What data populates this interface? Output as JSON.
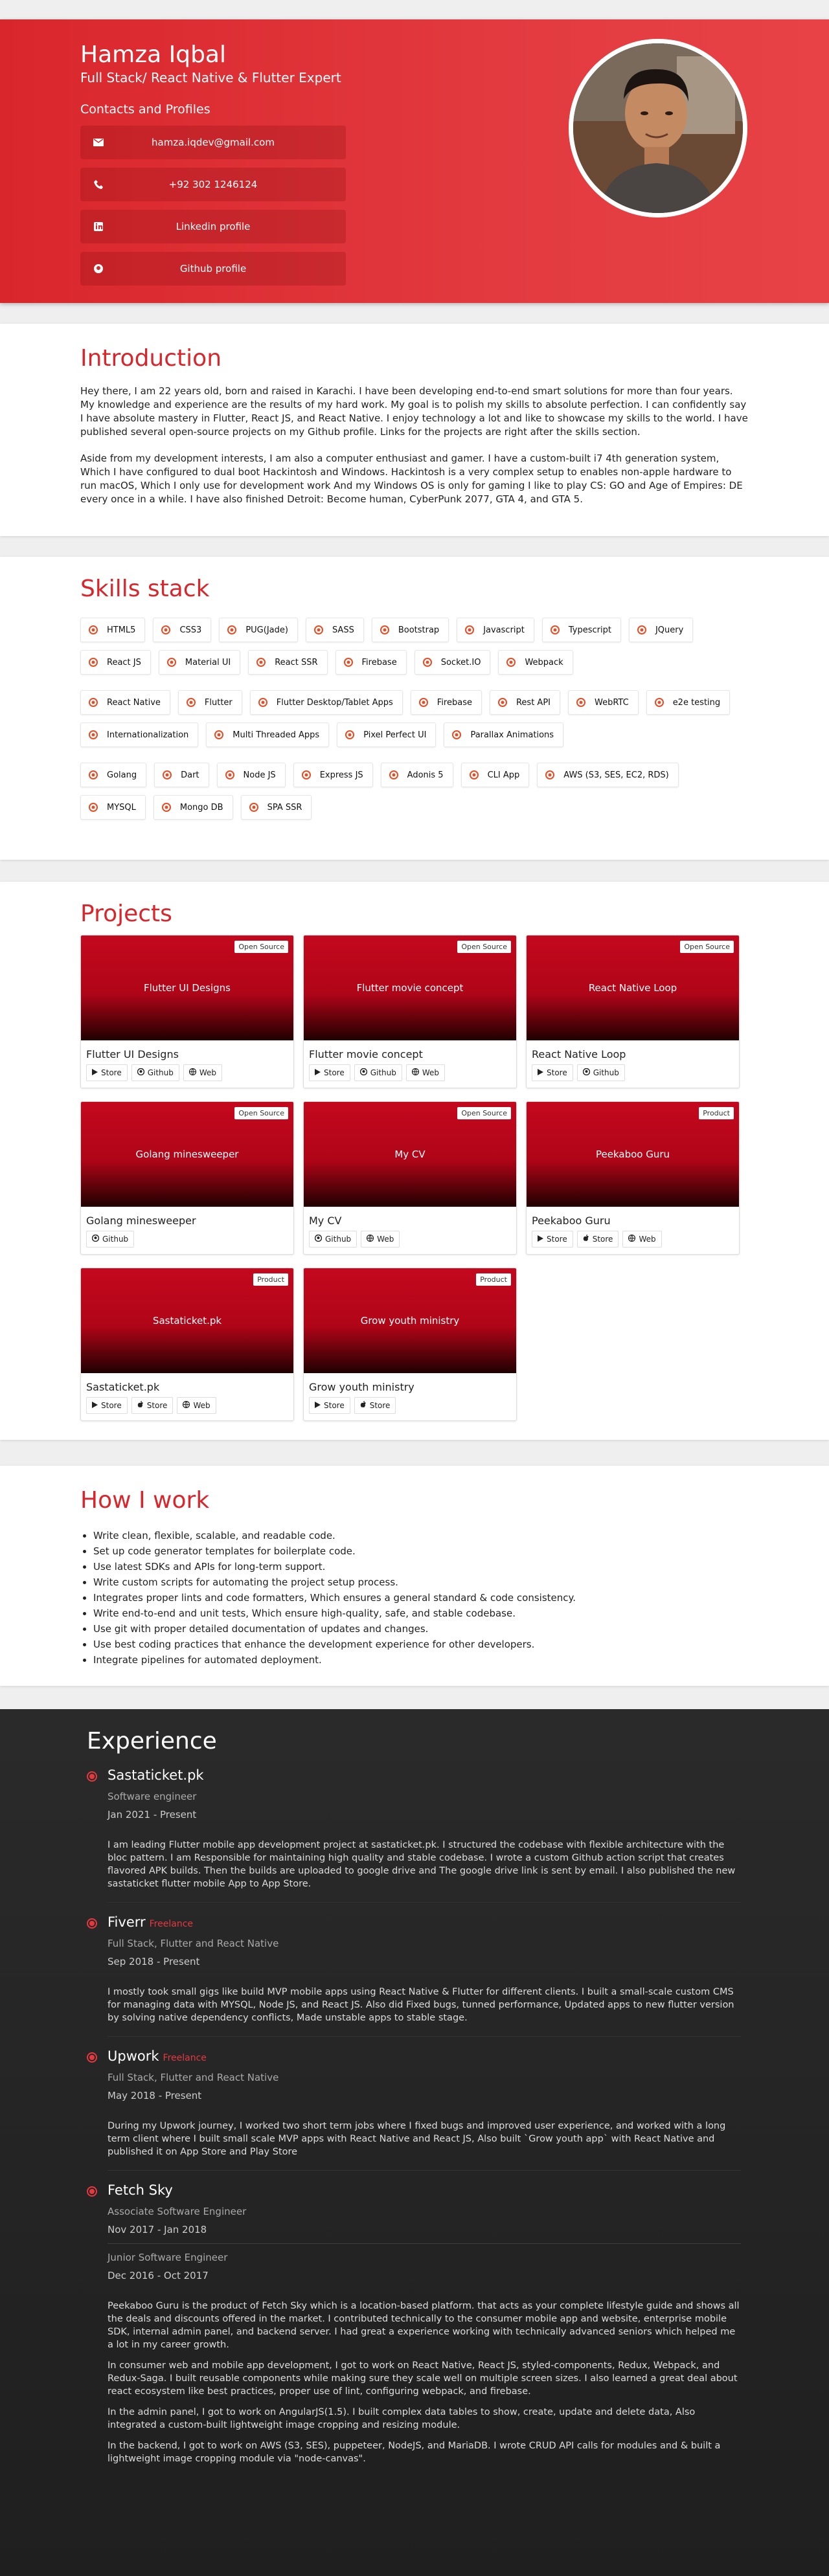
{
  "hero": {
    "name": "Hamza Iqbal",
    "subtitle": "Full Stack/ React Native & Flutter Expert",
    "contacts_title": "Contacts and Profiles",
    "contacts": [
      {
        "icon": "mail-icon",
        "label": "hamza.iqdev@gmail.com"
      },
      {
        "icon": "phone-icon",
        "label": "+92 302 1246124"
      },
      {
        "icon": "linkedin-icon",
        "label": "Linkedin profile"
      },
      {
        "icon": "github-icon",
        "label": "Github profile"
      }
    ]
  },
  "intro": {
    "title": "Introduction",
    "p1": "Hey there, I am 22 years old, born and raised in Karachi. I have been developing end-to-end smart solutions for more than four years. My knowledge and experience are the results of my hard work. My goal is to polish my skills to absolute perfection. I can confidently say I have absolute mastery in Flutter, React JS, and React Native. I enjoy technology a lot and like to showcase my skills to the world. I have published several open-source projects on my Github profile. Links for the projects are right after the skills section.",
    "p2": "Aside from my development interests, I am also a computer enthusiast and gamer. I have a custom-built i7 4th generation system, Which I have configured to dual boot Hackintosh and Windows. Hackintosh is a very complex setup to enables non-apple hardware to run macOS, Which I only use for development work And my Windows OS is only for gaming I like to play CS: GO and Age of Empires: DE every once in a while. I have also finished Detroit: Become human, CyberPunk 2077, GTA 4, and GTA 5."
  },
  "skills": {
    "title": "Skills stack",
    "rows": [
      [
        {
          "label": "HTML5",
          "icon": "html5-icon",
          "color": "#e44d26"
        },
        {
          "label": "CSS3",
          "icon": "css3-icon",
          "color": "#e44d26"
        },
        {
          "label": "PUG(Jade)",
          "icon": "pug-icon",
          "color": "#e44d26"
        },
        {
          "label": "SASS",
          "icon": "sass-icon",
          "color": "#e44d26"
        },
        {
          "label": "Bootstrap",
          "icon": "bootstrap-icon",
          "color": "#e44d26"
        },
        {
          "label": "Javascript",
          "icon": "javascript-icon",
          "color": "#e44d26"
        },
        {
          "label": "Typescript",
          "icon": "typescript-icon",
          "color": "#e44d26"
        },
        {
          "label": "JQuery",
          "icon": "jquery-icon",
          "color": "#e44d26"
        },
        {
          "label": "React JS",
          "icon": "react-icon",
          "color": "#e44d26"
        },
        {
          "label": "Material UI",
          "icon": "material-ui-icon",
          "color": "#e44d26"
        },
        {
          "label": "React SSR",
          "icon": "react-icon",
          "color": "#e44d26"
        },
        {
          "label": "Firebase",
          "icon": "firebase-icon",
          "color": "#e44d26"
        },
        {
          "label": "Socket.IO",
          "icon": "socketio-icon",
          "color": "#e44d26"
        },
        {
          "label": "Webpack",
          "icon": "webpack-icon",
          "color": "#e44d26"
        }
      ],
      [
        {
          "label": "React Native",
          "icon": "react-icon",
          "color": "#e44d26"
        },
        {
          "label": "Flutter",
          "icon": "flutter-icon",
          "color": "#e44d26"
        },
        {
          "label": "Flutter Desktop/Tablet Apps",
          "icon": "desktop-icon",
          "color": "#e44d26"
        },
        {
          "label": "Firebase",
          "icon": "firebase-icon",
          "color": "#e44d26"
        },
        {
          "label": "Rest API",
          "icon": "api-icon",
          "color": "#e44d26"
        },
        {
          "label": "WebRTC",
          "icon": "webrtc-icon",
          "color": "#e44d26"
        },
        {
          "label": "e2e testing",
          "icon": "testing-icon",
          "color": "#e44d26"
        },
        {
          "label": "Internationalization",
          "icon": "translate-icon",
          "color": "#e44d26"
        },
        {
          "label": "Multi Threaded Apps",
          "icon": "threads-icon",
          "color": "#e44d26"
        },
        {
          "label": "Pixel Perfect UI",
          "icon": "pixel-icon",
          "color": "#e44d26"
        },
        {
          "label": "Parallax Animations",
          "icon": "parallax-icon",
          "color": "#e44d26"
        }
      ],
      [
        {
          "label": "Golang",
          "icon": "golang-icon",
          "color": "#e44d26"
        },
        {
          "label": "Dart",
          "icon": "terminal-icon",
          "color": "#e44d26"
        },
        {
          "label": "Node JS",
          "icon": "nodejs-icon",
          "color": "#e44d26"
        },
        {
          "label": "Express JS",
          "icon": "cloud-icon",
          "color": "#e44d26"
        },
        {
          "label": "Adonis 5",
          "icon": "cloud-icon",
          "color": "#e44d26"
        },
        {
          "label": "CLI App",
          "icon": "terminal-icon",
          "color": "#e44d26"
        },
        {
          "label": "AWS (S3, SES, EC2, RDS)",
          "icon": "cloud-icon",
          "color": "#e44d26"
        },
        {
          "label": "MYSQL",
          "icon": "database-icon",
          "color": "#e44d26"
        },
        {
          "label": "Mongo DB",
          "icon": "database-icon",
          "color": "#e44d26"
        },
        {
          "label": "SPA SSR",
          "icon": "cloud-icon",
          "color": "#e44d26"
        }
      ]
    ]
  },
  "projects": {
    "title": "Projects",
    "items": [
      {
        "title": "Flutter UI Designs",
        "badge": "Open Source",
        "buttons": [
          {
            "icon": "play-icon",
            "label": "Store"
          },
          {
            "icon": "github-icon",
            "label": "Github"
          },
          {
            "icon": "globe-icon",
            "label": "Web"
          }
        ]
      },
      {
        "title": "Flutter movie concept",
        "badge": "Open Source",
        "buttons": [
          {
            "icon": "play-icon",
            "label": "Store"
          },
          {
            "icon": "github-icon",
            "label": "Github"
          },
          {
            "icon": "globe-icon",
            "label": "Web"
          }
        ]
      },
      {
        "title": "React Native Loop",
        "badge": "Open Source",
        "buttons": [
          {
            "icon": "play-icon",
            "label": "Store"
          },
          {
            "icon": "github-icon",
            "label": "Github"
          }
        ]
      },
      {
        "title": "Golang minesweeper",
        "badge": "Open Source",
        "buttons": [
          {
            "icon": "github-icon",
            "label": "Github"
          }
        ]
      },
      {
        "title": "My CV",
        "badge": "Open Source",
        "buttons": [
          {
            "icon": "github-icon",
            "label": "Github"
          },
          {
            "icon": "globe-icon",
            "label": "Web"
          }
        ]
      },
      {
        "title": "Peekaboo Guru",
        "badge": "Product",
        "buttons": [
          {
            "icon": "play-icon",
            "label": "Store"
          },
          {
            "icon": "apple-icon",
            "label": "Store"
          },
          {
            "icon": "globe-icon",
            "label": "Web"
          }
        ]
      },
      {
        "title": "Sastaticket.pk",
        "badge": "Product",
        "buttons": [
          {
            "icon": "play-icon",
            "label": "Store"
          },
          {
            "icon": "apple-icon",
            "label": "Store"
          },
          {
            "icon": "globe-icon",
            "label": "Web"
          }
        ]
      },
      {
        "title": "Grow youth ministry",
        "badge": "Product",
        "buttons": [
          {
            "icon": "play-icon",
            "label": "Store"
          },
          {
            "icon": "apple-icon",
            "label": "Store"
          }
        ]
      }
    ]
  },
  "howiwork": {
    "title": "How I work",
    "items": [
      "Write clean, flexible, scalable, and readable code.",
      "Set up code generator templates for boilerplate code.",
      "Use latest SDKs and APIs for long-term support.",
      "Write custom scripts for automating the project setup process.",
      "Integrates proper lints and code formatters, Which ensures a general standard & code consistency.",
      "Write end-to-end and unit tests, Which ensure high-quality, safe, and stable codebase.",
      "Use git with proper detailed documentation of updates and changes.",
      "Use best coding practices that enhance the development experience for other developers.",
      "Integrate pipelines for automated deployment."
    ]
  },
  "experience": {
    "title": "Experience",
    "jobs": [
      {
        "company": "Sastaticket.pk",
        "tag": "",
        "roles": [
          {
            "role": "Software engineer",
            "date": "Jan 2021 - Present"
          }
        ],
        "desc": [
          "I am leading Flutter mobile app development project at sastaticket.pk. I structured the codebase with flexible architecture with the bloc pattern. I am Responsible for maintaining high quality and stable codebase. I wrote a custom Github action script that creates flavored APK builds. Then the builds are uploaded to google drive and The google drive link is sent by email. I also published the new sastaticket flutter mobile App to App Store."
        ]
      },
      {
        "company": "Fiverr",
        "tag": "Freelance",
        "roles": [
          {
            "role": "Full Stack, Flutter and React Native",
            "date": "Sep 2018 - Present"
          }
        ],
        "desc": [
          "I mostly took small gigs like build MVP mobile apps using React Native & Flutter for different clients. I built a small-scale custom CMS for managing data with MYSQL, Node JS, and React JS. Also did Fixed bugs, tunned performance, Updated apps to new flutter version by solving native dependency conflicts, Made unstable apps to stable stage."
        ]
      },
      {
        "company": "Upwork",
        "tag": "Freelance",
        "roles": [
          {
            "role": "Full Stack, Flutter and React Native",
            "date": "May 2018 - Present"
          }
        ],
        "desc": [
          "During my Upwork journey, I worked two short term jobs where I fixed bugs and improved user experience, and worked with a long term client where I built small scale MVP apps with React Native and React JS, Also built `Grow youth app` with React Native and published it on App Store and Play Store"
        ]
      },
      {
        "company": "Fetch Sky",
        "tag": "",
        "roles": [
          {
            "role": "Associate Software Engineer",
            "date": "Nov 2017 - Jan 2018"
          },
          {
            "role": "Junior Software Engineer",
            "date": "Dec 2016 - Oct 2017"
          }
        ],
        "desc": [
          "Peekaboo Guru is the product of Fetch Sky which is a location-based platform. that acts as your complete lifestyle guide and shows all the deals and discounts offered in the market. I contributed technically to the consumer mobile app and website, enterprise mobile SDK, internal admin panel, and backend server. I had great a experience working with technically advanced seniors which helped me a lot in my career growth.",
          "In consumer web and mobile app development, I got to work on React Native, React JS, styled-components, Redux, Webpack, and Redux-Saga. I built reusable components while making sure they scale well on multiple screen sizes. I also learned a great deal about react ecosystem like best practices, proper use of lint, configuring webpack, and firebase.",
          "In the admin panel, I got to work on AngularJS(1.5). I built complex data tables to show, create, update and delete data, Also integrated a custom-built lightweight image cropping and resizing module.",
          "In the backend, I got to work on AWS (S3, SES), puppeteer, NodeJS, and MariaDB. I wrote CRUD API calls for modules and & built a lightweight image cropping module via \"node-canvas\"."
        ]
      }
    ]
  }
}
